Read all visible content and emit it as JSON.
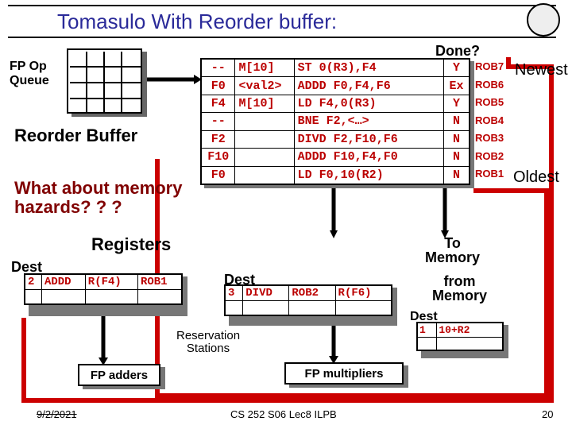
{
  "title": "Tomasulo With Reorder buffer:",
  "labels": {
    "fp_op_queue": "FP Op\nQueue",
    "done": "Done?",
    "newest": "Newest",
    "oldest": "Oldest",
    "reorder_buffer": "Reorder Buffer",
    "hazards": "What about memory\nhazards? ? ?",
    "registers": "Registers",
    "dest1": "Dest",
    "dest2": "Dest",
    "dest3": "Dest",
    "to_memory": "To\nMemory",
    "from_memory": "from\nMemory",
    "reservation": "Reservation\nStations",
    "fp_adders": "FP adders",
    "fp_multipliers": "FP multipliers"
  },
  "rob": [
    {
      "dest": "--",
      "val": "M[10]",
      "op": "ST 0(R3),F4",
      "done": "Y",
      "tag": "ROB7"
    },
    {
      "dest": "F0",
      "val": "<val2>",
      "op": "ADDD F0,F4,F6",
      "done": "Ex",
      "tag": "ROB6"
    },
    {
      "dest": "F4",
      "val": "M[10]",
      "op": "LD F4,0(R3)",
      "done": "Y",
      "tag": "ROB5"
    },
    {
      "dest": "--",
      "val": "",
      "op": "BNE F2,<…>",
      "done": "N",
      "tag": "ROB4"
    },
    {
      "dest": "F2",
      "val": "",
      "op": "DIVD F2,F10,F6",
      "done": "N",
      "tag": "ROB3"
    },
    {
      "dest": "F10",
      "val": "",
      "op": "ADDD F10,F4,F0",
      "done": "N",
      "tag": "ROB2"
    },
    {
      "dest": "F0",
      "val": "",
      "op": "LD F0,10(R2)",
      "done": "N",
      "tag": "ROB1"
    }
  ],
  "rs_add": {
    "num": "2",
    "op": "ADDD",
    "src1": "R(F4)",
    "src2": "ROB1"
  },
  "rs_mul": {
    "num": "3",
    "op": "DIVD",
    "src1": "ROB2",
    "src2": "R(F6)"
  },
  "rs_load": {
    "num": "1",
    "addr": "10+R2"
  },
  "footer": {
    "date": "9/2/2021",
    "center": "CS 252 S06 Lec8 ILPB",
    "page": "20"
  }
}
